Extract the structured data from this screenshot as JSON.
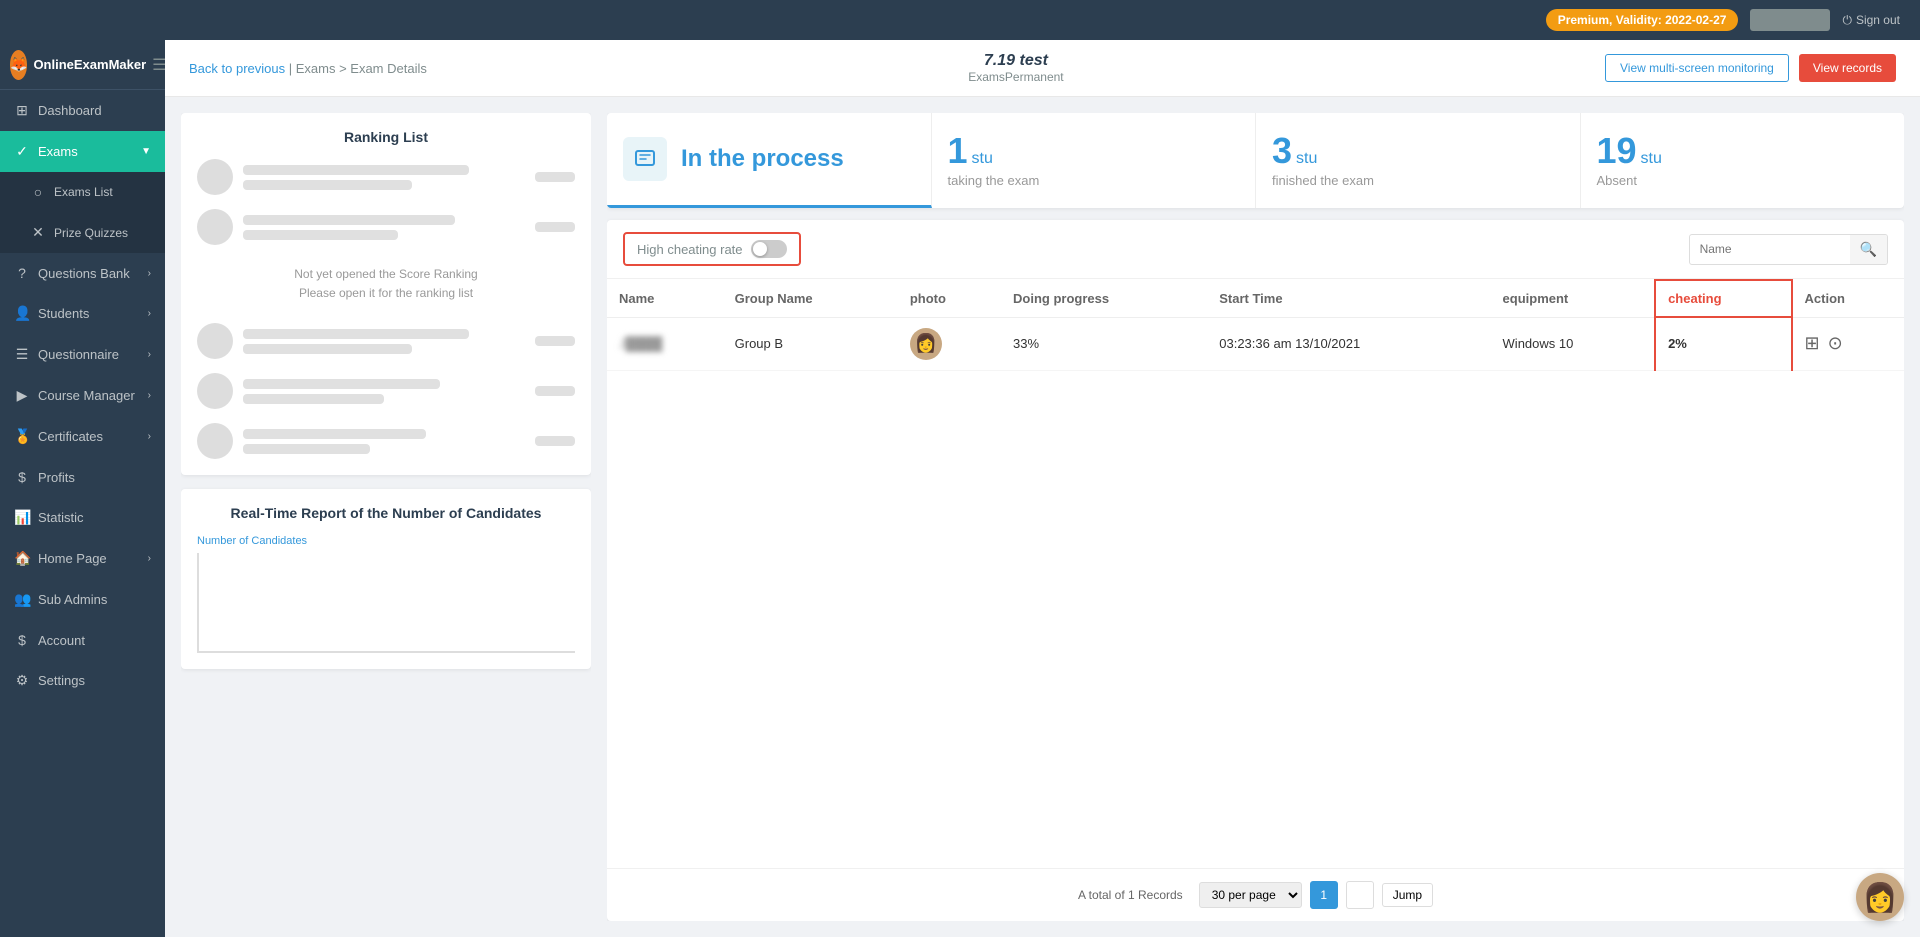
{
  "topnav": {
    "premium_label": "Premium, Validity: 2022-02-27",
    "sign_out_label": "Sign out"
  },
  "sidebar": {
    "logo_text": "OnlineExamMaker",
    "items": [
      {
        "id": "dashboard",
        "label": "Dashboard",
        "icon": "⊞"
      },
      {
        "id": "exams",
        "label": "Exams",
        "icon": "✓",
        "active": true,
        "expanded": true
      },
      {
        "id": "exams-list",
        "label": "Exams List",
        "icon": "○",
        "sub": true
      },
      {
        "id": "prize-quizzes",
        "label": "Prize Quizzes",
        "icon": "✕",
        "sub": true
      },
      {
        "id": "questions-bank",
        "label": "Questions Bank",
        "icon": "?"
      },
      {
        "id": "students",
        "label": "Students",
        "icon": "👤"
      },
      {
        "id": "questionnaire",
        "label": "Questionnaire",
        "icon": "☰"
      },
      {
        "id": "course-manager",
        "label": "Course Manager",
        "icon": "▶"
      },
      {
        "id": "certificates",
        "label": "Certificates",
        "icon": "🏅"
      },
      {
        "id": "profits",
        "label": "Profits",
        "icon": "$"
      },
      {
        "id": "statistic",
        "label": "Statistic",
        "icon": "📊"
      },
      {
        "id": "home-page",
        "label": "Home Page",
        "icon": "🏠"
      },
      {
        "id": "sub-admins",
        "label": "Sub Admins",
        "icon": "👥"
      },
      {
        "id": "account",
        "label": "Account",
        "icon": "$"
      },
      {
        "id": "settings",
        "label": "Settings",
        "icon": "⚙"
      }
    ]
  },
  "header": {
    "breadcrumb_back": "Back to previous",
    "breadcrumb_sep": "|",
    "breadcrumb_path": "Exams > Exam Details",
    "exam_title": "7.19 test",
    "exam_subtitle": "ExamsPermanent",
    "btn_monitor": "View multi-screen monitoring",
    "btn_records": "View records"
  },
  "stats": {
    "in_process_label": "In the process",
    "tab1_count": "1",
    "tab1_unit": "stu",
    "tab1_label": "taking the exam",
    "tab2_count": "3",
    "tab2_unit": "stu",
    "tab2_label": "finished the exam",
    "tab3_count": "19",
    "tab3_unit": "stu",
    "tab3_label": "Absent"
  },
  "filter": {
    "label": "High cheating rate",
    "search_placeholder": "Name"
  },
  "table": {
    "col_name": "Name",
    "col_group": "Group Name",
    "col_photo": "photo",
    "col_progress": "Doing progress",
    "col_start_time": "Start Time",
    "col_equipment": "equipment",
    "col_cheating": "cheating",
    "col_action": "Action",
    "rows": [
      {
        "name": "J...",
        "group": "Group B",
        "progress": "33%",
        "start_time": "03:23:36 am 13/10/2021",
        "equipment": "Windows 10",
        "cheating": "2%"
      }
    ]
  },
  "pagination": {
    "total_info": "A total of 1 Records",
    "per_page": "30 per page",
    "page": "1",
    "jump_label": "Jump"
  },
  "ranking": {
    "title": "Ranking List",
    "empty_msg_line1": "Not yet opened the Score Ranking",
    "empty_msg_line2": "Please open it for the ranking list"
  },
  "report": {
    "title": "Real-Time Report of the Number of Candidates",
    "y_label": "Number of Candidates"
  }
}
